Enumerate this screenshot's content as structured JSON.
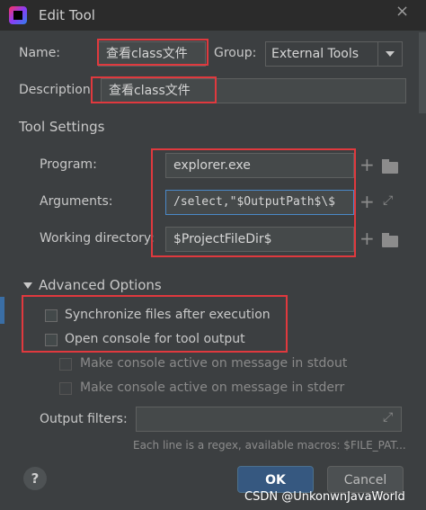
{
  "window": {
    "title": "Edit Tool",
    "close_glyph": "×"
  },
  "name": {
    "label": "Name:",
    "value": "查看class文件"
  },
  "group": {
    "label": "Group:",
    "value": "External Tools"
  },
  "description": {
    "label": "Description",
    "value": "查看class文件"
  },
  "tool_settings": {
    "heading": "Tool Settings",
    "program": {
      "label": "Program:",
      "value": "explorer.exe"
    },
    "arguments": {
      "label": "Arguments:",
      "value": "/select,\"$OutputPath$\\$"
    },
    "working_directory": {
      "label": "Working directory:",
      "value": "$ProjectFileDir$"
    }
  },
  "advanced": {
    "heading": "Advanced Options",
    "sync_files": {
      "label": "Synchronize files after execution",
      "checked": false
    },
    "open_console": {
      "label": "Open console for tool output",
      "checked": false
    },
    "console_stdout": {
      "label": "Make console active on message in stdout",
      "checked": false
    },
    "console_stderr": {
      "label": "Make console active on message in stderr",
      "checked": false
    },
    "output_filters": {
      "label": "Output filters:",
      "value": ""
    },
    "hint": "Each line is a regex, available macros: $FILE_PAT..."
  },
  "buttons": {
    "help": "?",
    "ok": "OK",
    "cancel": "Cancel"
  },
  "icons": {
    "add": "plus-icon",
    "browse": "folder-icon",
    "expand": "expand-icon",
    "dropdown": "chevron-down-icon"
  },
  "watermark": "CSDN @UnkonwnJavaWorld",
  "colors": {
    "highlight_box": "#e0393e",
    "ok_button": "#365880",
    "background": "#3c3f41"
  }
}
